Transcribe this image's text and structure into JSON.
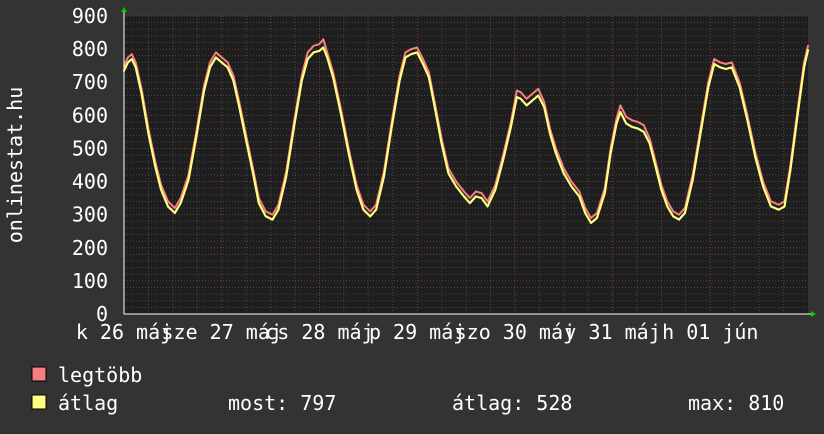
{
  "chart_data": {
    "type": "line",
    "ylabel": "onlinestat.hu",
    "ylim": [
      0,
      900
    ],
    "yticks": [
      0,
      100,
      200,
      300,
      400,
      500,
      600,
      700,
      800,
      900
    ],
    "xticks": [
      {
        "label": "k 26 máj",
        "day_offset": 0
      },
      {
        "label": "sze 27 máj",
        "day_offset": 1
      },
      {
        "label": "cs 28 máj",
        "day_offset": 2
      },
      {
        "label": "p 29 máj",
        "day_offset": 3
      },
      {
        "label": "szo 30 máj",
        "day_offset": 4
      },
      {
        "label": "v 31 máj",
        "day_offset": 5
      },
      {
        "label": "h 01 jún",
        "day_offset": 6
      }
    ],
    "grid": true,
    "colors": {
      "background": "#333333",
      "plot_background": "#1e1e1e",
      "grid_major": "#7a3a3a",
      "grid_minor": "#555555",
      "axis_arrow": "#00cc00",
      "text": "#ffffff"
    },
    "series": [
      {
        "name": "legtöbb",
        "color": "#f87f7f",
        "points": [
          [
            0.0,
            750
          ],
          [
            0.04,
            775
          ],
          [
            0.08,
            785
          ],
          [
            0.12,
            760
          ],
          [
            0.18,
            680
          ],
          [
            0.25,
            560
          ],
          [
            0.32,
            460
          ],
          [
            0.38,
            390
          ],
          [
            0.45,
            340
          ],
          [
            0.52,
            320
          ],
          [
            0.58,
            350
          ],
          [
            0.66,
            420
          ],
          [
            0.74,
            550
          ],
          [
            0.82,
            690
          ],
          [
            0.88,
            760
          ],
          [
            0.94,
            790
          ],
          [
            1.0,
            775
          ],
          [
            1.06,
            760
          ],
          [
            1.12,
            720
          ],
          [
            1.18,
            640
          ],
          [
            1.25,
            540
          ],
          [
            1.32,
            440
          ],
          [
            1.38,
            350
          ],
          [
            1.45,
            310
          ],
          [
            1.52,
            300
          ],
          [
            1.58,
            330
          ],
          [
            1.66,
            430
          ],
          [
            1.74,
            580
          ],
          [
            1.82,
            720
          ],
          [
            1.88,
            790
          ],
          [
            1.94,
            810
          ],
          [
            2.0,
            815
          ],
          [
            2.04,
            830
          ],
          [
            2.08,
            790
          ],
          [
            2.14,
            730
          ],
          [
            2.22,
            620
          ],
          [
            2.3,
            500
          ],
          [
            2.38,
            390
          ],
          [
            2.45,
            330
          ],
          [
            2.52,
            310
          ],
          [
            2.58,
            330
          ],
          [
            2.66,
            430
          ],
          [
            2.74,
            580
          ],
          [
            2.82,
            720
          ],
          [
            2.88,
            790
          ],
          [
            2.94,
            800
          ],
          [
            3.0,
            805
          ],
          [
            3.06,
            770
          ],
          [
            3.12,
            730
          ],
          [
            3.18,
            640
          ],
          [
            3.25,
            530
          ],
          [
            3.32,
            440
          ],
          [
            3.4,
            400
          ],
          [
            3.48,
            370
          ],
          [
            3.54,
            350
          ],
          [
            3.6,
            370
          ],
          [
            3.66,
            365
          ],
          [
            3.72,
            340
          ],
          [
            3.8,
            390
          ],
          [
            3.88,
            480
          ],
          [
            3.96,
            580
          ],
          [
            4.02,
            675
          ],
          [
            4.06,
            670
          ],
          [
            4.12,
            650
          ],
          [
            4.18,
            665
          ],
          [
            4.24,
            680
          ],
          [
            4.3,
            640
          ],
          [
            4.36,
            560
          ],
          [
            4.42,
            500
          ],
          [
            4.5,
            440
          ],
          [
            4.58,
            400
          ],
          [
            4.66,
            370
          ],
          [
            4.72,
            320
          ],
          [
            4.78,
            290
          ],
          [
            4.84,
            305
          ],
          [
            4.92,
            380
          ],
          [
            4.98,
            500
          ],
          [
            5.04,
            590
          ],
          [
            5.08,
            630
          ],
          [
            5.14,
            595
          ],
          [
            5.2,
            585
          ],
          [
            5.26,
            580
          ],
          [
            5.32,
            570
          ],
          [
            5.38,
            530
          ],
          [
            5.44,
            460
          ],
          [
            5.5,
            390
          ],
          [
            5.56,
            340
          ],
          [
            5.62,
            310
          ],
          [
            5.68,
            300
          ],
          [
            5.74,
            320
          ],
          [
            5.82,
            420
          ],
          [
            5.9,
            560
          ],
          [
            5.98,
            700
          ],
          [
            6.04,
            770
          ],
          [
            6.1,
            760
          ],
          [
            6.16,
            755
          ],
          [
            6.22,
            760
          ],
          [
            6.3,
            700
          ],
          [
            6.38,
            600
          ],
          [
            6.46,
            490
          ],
          [
            6.54,
            400
          ],
          [
            6.62,
            340
          ],
          [
            6.7,
            330
          ],
          [
            6.76,
            340
          ],
          [
            6.82,
            450
          ],
          [
            6.9,
            630
          ],
          [
            6.96,
            760
          ],
          [
            7.0,
            810
          ]
        ]
      },
      {
        "name": "átlag",
        "color": "#ffff80",
        "points": [
          [
            0.0,
            735
          ],
          [
            0.04,
            760
          ],
          [
            0.08,
            770
          ],
          [
            0.12,
            745
          ],
          [
            0.18,
            665
          ],
          [
            0.25,
            545
          ],
          [
            0.32,
            445
          ],
          [
            0.38,
            375
          ],
          [
            0.45,
            325
          ],
          [
            0.52,
            305
          ],
          [
            0.58,
            335
          ],
          [
            0.66,
            405
          ],
          [
            0.74,
            535
          ],
          [
            0.82,
            675
          ],
          [
            0.88,
            745
          ],
          [
            0.94,
            775
          ],
          [
            1.0,
            760
          ],
          [
            1.06,
            745
          ],
          [
            1.12,
            705
          ],
          [
            1.18,
            625
          ],
          [
            1.25,
            525
          ],
          [
            1.32,
            425
          ],
          [
            1.38,
            335
          ],
          [
            1.45,
            295
          ],
          [
            1.52,
            285
          ],
          [
            1.58,
            315
          ],
          [
            1.66,
            415
          ],
          [
            1.74,
            565
          ],
          [
            1.82,
            705
          ],
          [
            1.88,
            770
          ],
          [
            1.94,
            790
          ],
          [
            2.0,
            795
          ],
          [
            2.04,
            805
          ],
          [
            2.08,
            775
          ],
          [
            2.14,
            715
          ],
          [
            2.22,
            605
          ],
          [
            2.3,
            485
          ],
          [
            2.38,
            375
          ],
          [
            2.45,
            315
          ],
          [
            2.52,
            295
          ],
          [
            2.58,
            315
          ],
          [
            2.66,
            415
          ],
          [
            2.74,
            565
          ],
          [
            2.82,
            705
          ],
          [
            2.88,
            775
          ],
          [
            2.94,
            785
          ],
          [
            3.0,
            790
          ],
          [
            3.06,
            755
          ],
          [
            3.12,
            715
          ],
          [
            3.18,
            625
          ],
          [
            3.25,
            515
          ],
          [
            3.32,
            425
          ],
          [
            3.4,
            385
          ],
          [
            3.48,
            355
          ],
          [
            3.54,
            335
          ],
          [
            3.6,
            355
          ],
          [
            3.66,
            350
          ],
          [
            3.72,
            325
          ],
          [
            3.8,
            375
          ],
          [
            3.88,
            465
          ],
          [
            3.96,
            565
          ],
          [
            4.02,
            655
          ],
          [
            4.06,
            650
          ],
          [
            4.12,
            630
          ],
          [
            4.18,
            645
          ],
          [
            4.24,
            660
          ],
          [
            4.3,
            625
          ],
          [
            4.36,
            545
          ],
          [
            4.42,
            485
          ],
          [
            4.5,
            425
          ],
          [
            4.58,
            385
          ],
          [
            4.66,
            355
          ],
          [
            4.72,
            305
          ],
          [
            4.78,
            275
          ],
          [
            4.84,
            290
          ],
          [
            4.92,
            365
          ],
          [
            4.98,
            485
          ],
          [
            5.04,
            575
          ],
          [
            5.08,
            610
          ],
          [
            5.14,
            575
          ],
          [
            5.2,
            565
          ],
          [
            5.26,
            560
          ],
          [
            5.32,
            550
          ],
          [
            5.38,
            515
          ],
          [
            5.44,
            445
          ],
          [
            5.5,
            375
          ],
          [
            5.56,
            325
          ],
          [
            5.62,
            295
          ],
          [
            5.68,
            285
          ],
          [
            5.74,
            305
          ],
          [
            5.82,
            405
          ],
          [
            5.9,
            545
          ],
          [
            5.98,
            685
          ],
          [
            6.04,
            755
          ],
          [
            6.1,
            745
          ],
          [
            6.16,
            740
          ],
          [
            6.22,
            745
          ],
          [
            6.3,
            685
          ],
          [
            6.38,
            585
          ],
          [
            6.46,
            475
          ],
          [
            6.54,
            385
          ],
          [
            6.62,
            325
          ],
          [
            6.7,
            315
          ],
          [
            6.76,
            325
          ],
          [
            6.82,
            435
          ],
          [
            6.9,
            615
          ],
          [
            6.96,
            745
          ],
          [
            7.0,
            797
          ]
        ]
      }
    ]
  },
  "legend": {
    "items": [
      {
        "label": "legtöbb",
        "color": "#f87f7f"
      },
      {
        "label": "átlag",
        "color": "#ffff80"
      }
    ],
    "stats": {
      "most": "most: 797",
      "atlag": "átlag: 528",
      "max": "max: 810"
    }
  }
}
